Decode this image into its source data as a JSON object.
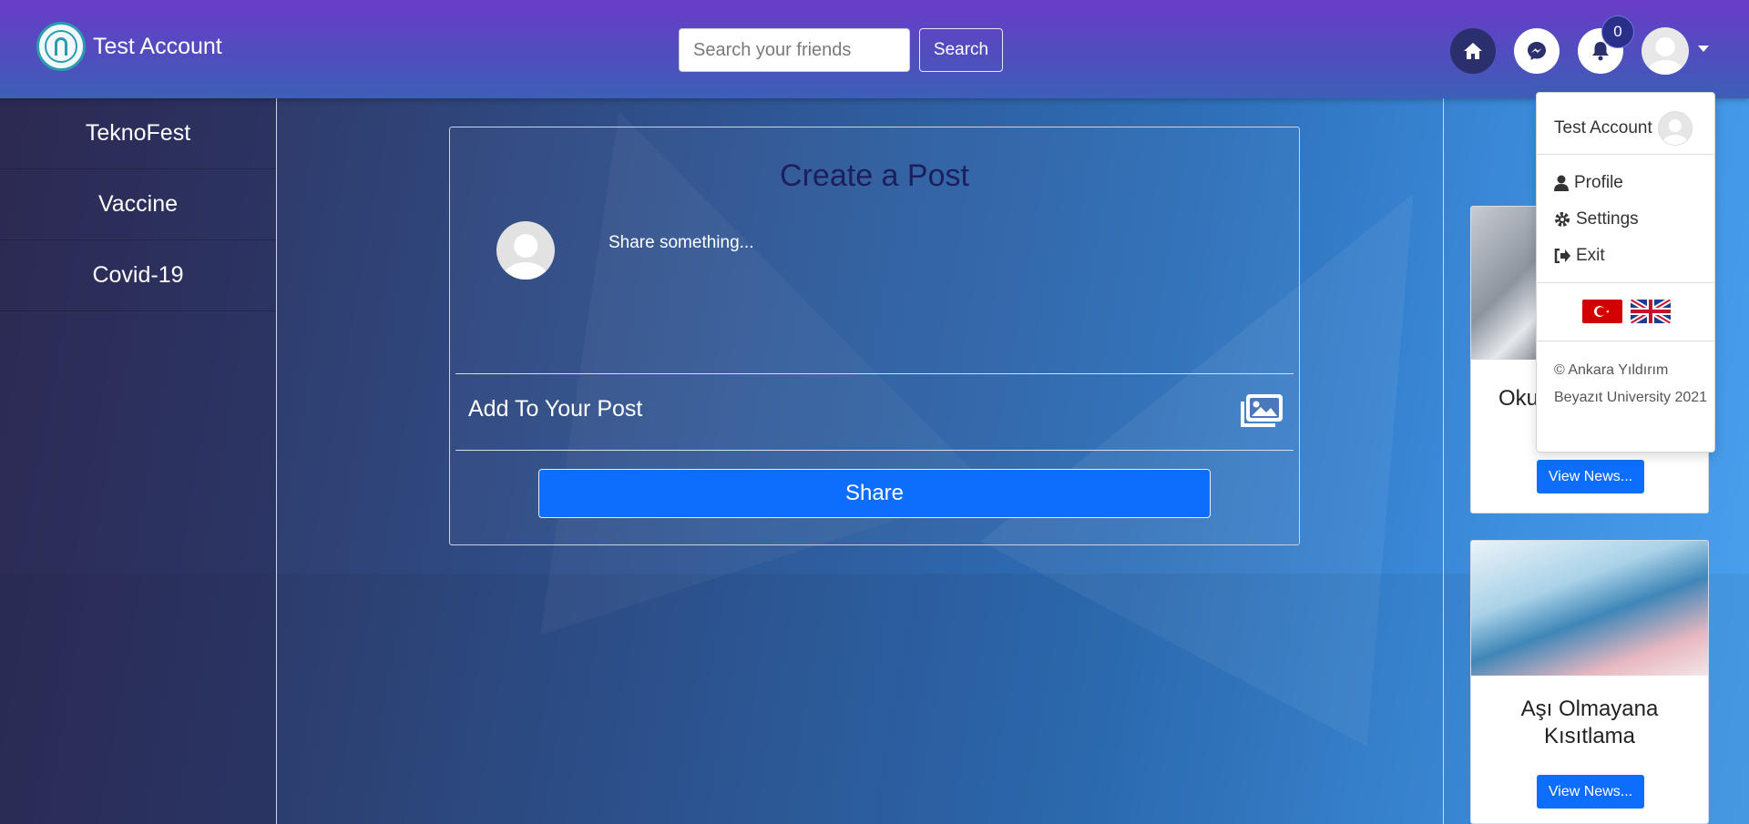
{
  "header": {
    "account_name": "Test Account",
    "search_placeholder": "Search your friends",
    "search_button": "Search",
    "notification_count": "0"
  },
  "sidebar": {
    "items": [
      {
        "label": "TeknoFest"
      },
      {
        "label": "Vaccine"
      },
      {
        "label": "Covid-19"
      }
    ]
  },
  "post": {
    "title": "Create a Post",
    "placeholder": "Share something...",
    "add_label": "Add To Your Post",
    "share_button": "Share"
  },
  "news": [
    {
      "title": "Oku",
      "button": "View News..."
    },
    {
      "title": "Aşı Olmayana Kısıtlama",
      "button": "View News..."
    }
  ],
  "dropdown": {
    "user": "Test Account",
    "items": [
      {
        "label": "Profile",
        "icon": "user-icon"
      },
      {
        "label": "Settings",
        "icon": "gear-icon"
      },
      {
        "label": "Exit",
        "icon": "sign-out-icon"
      }
    ],
    "copyright": "© Ankara Yıldırım Beyazıt University 2021"
  },
  "colors": {
    "primary": "#0d6efd",
    "navbar_top": "#6a3cc8",
    "title": "#1c1f5c"
  }
}
